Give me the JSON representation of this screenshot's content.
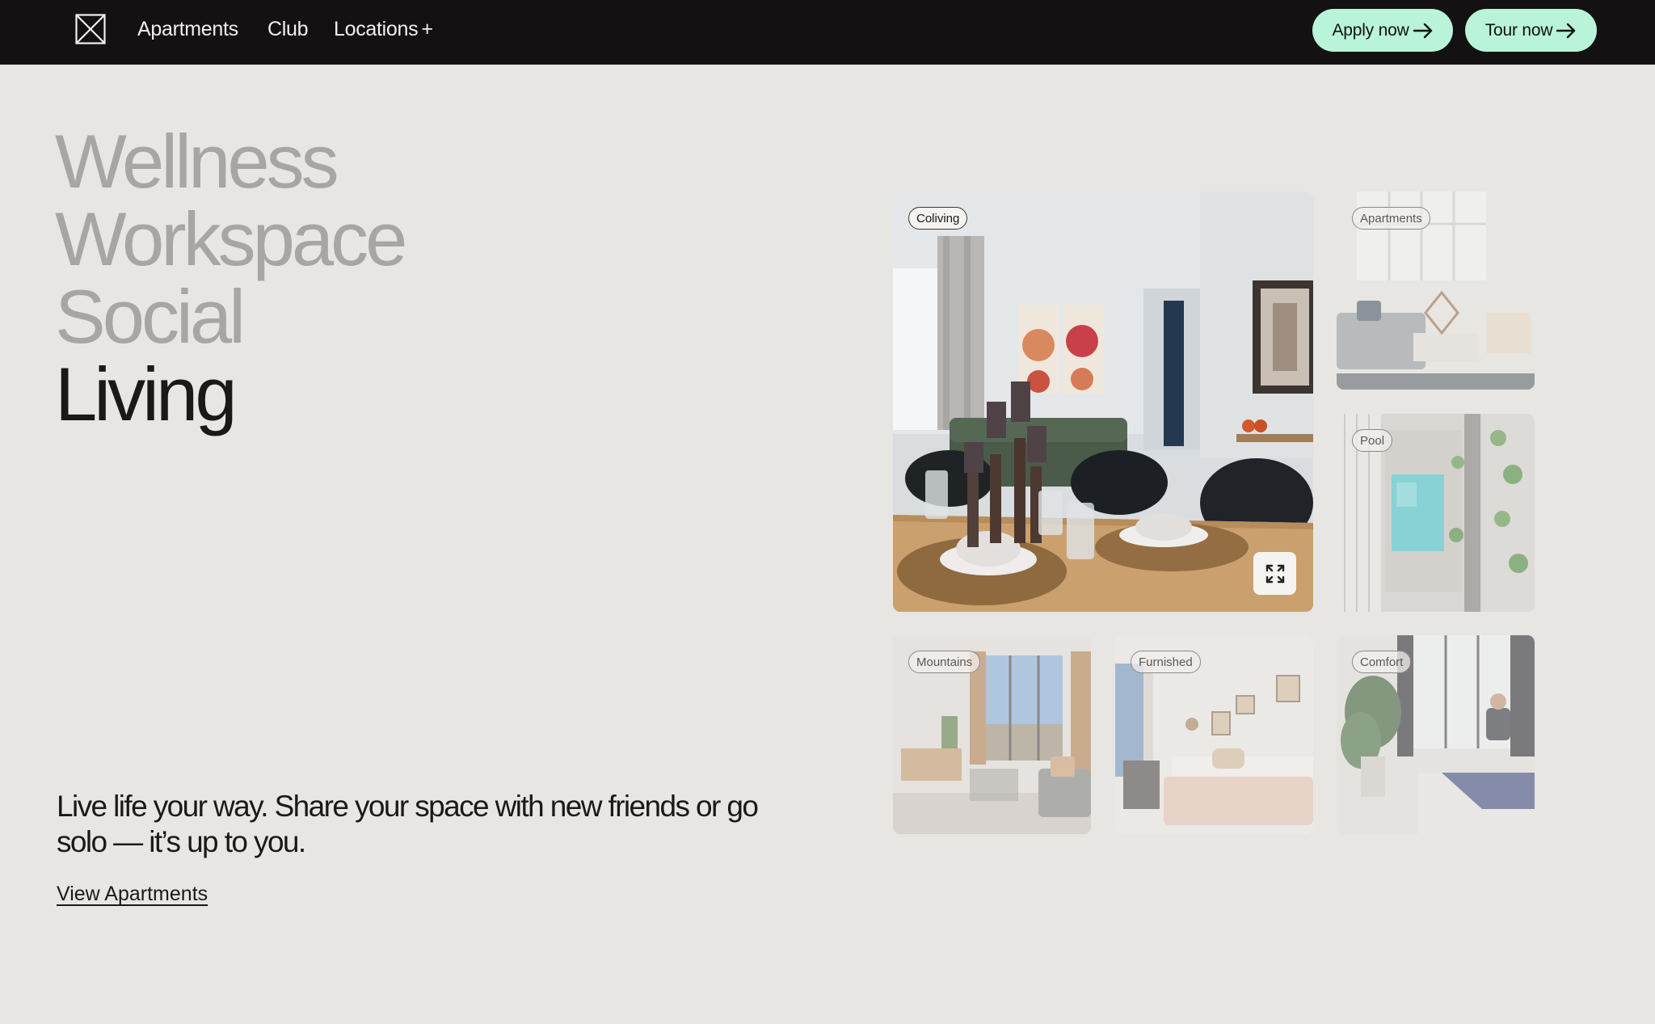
{
  "nav": {
    "logo_icon": "x-box-logo-icon",
    "links": {
      "apartments": "Apartments",
      "club": "Club",
      "locations": "Locations",
      "locations_plus": "+"
    },
    "apply_label": "Apply now",
    "tour_label": "Tour now",
    "cta_color": "#b8f3da",
    "bar_color": "#141112"
  },
  "hero": {
    "words": [
      "Wellness",
      "Workspace",
      "Social",
      "Living"
    ],
    "active_word": "Living",
    "tagline": "Live life your way. Share your space with new friends or go solo — it’s up to you.",
    "cta_link": "View Apartments"
  },
  "gallery": {
    "tiles": [
      {
        "tag": "Coliving",
        "active": true
      },
      {
        "tag": "Apartments",
        "active": false
      },
      {
        "tag": "Pool",
        "active": false
      },
      {
        "tag": "Mountains",
        "active": false
      },
      {
        "tag": "Furnished",
        "active": false
      },
      {
        "tag": "Comfort",
        "active": false
      }
    ],
    "expand_icon": "expand-icon"
  }
}
